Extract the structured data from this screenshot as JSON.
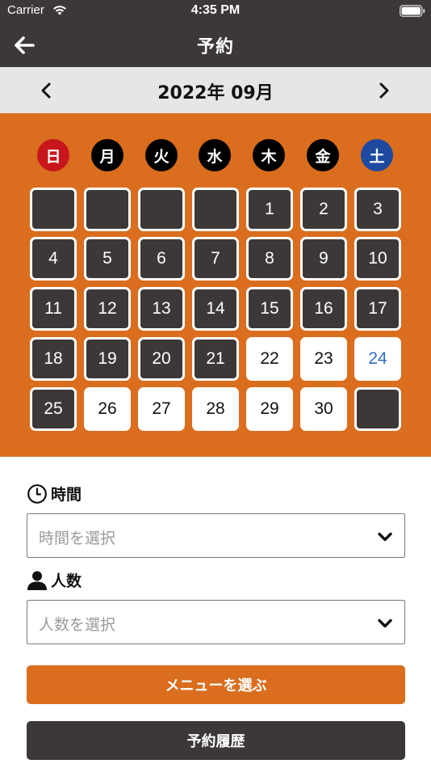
{
  "status": {
    "carrier": "Carrier",
    "time": "4:35 PM"
  },
  "nav": {
    "back_icon": "arrow-left-icon",
    "title": "予約"
  },
  "month": {
    "title": "2022年 09月",
    "prev_icon": "chevron-left-icon",
    "next_icon": "chevron-right-icon"
  },
  "weekdays": [
    "日",
    "月",
    "火",
    "水",
    "木",
    "金",
    "土"
  ],
  "calendar": {
    "weeks": [
      [
        {
          "d": "",
          "s": "dark"
        },
        {
          "d": "",
          "s": "dark"
        },
        {
          "d": "",
          "s": "dark"
        },
        {
          "d": "",
          "s": "dark"
        },
        {
          "d": "1",
          "s": "dark"
        },
        {
          "d": "2",
          "s": "dark"
        },
        {
          "d": "3",
          "s": "dark"
        }
      ],
      [
        {
          "d": "4",
          "s": "dark"
        },
        {
          "d": "5",
          "s": "dark"
        },
        {
          "d": "6",
          "s": "dark"
        },
        {
          "d": "7",
          "s": "dark"
        },
        {
          "d": "8",
          "s": "dark"
        },
        {
          "d": "9",
          "s": "dark"
        },
        {
          "d": "10",
          "s": "dark"
        }
      ],
      [
        {
          "d": "11",
          "s": "dark"
        },
        {
          "d": "12",
          "s": "dark"
        },
        {
          "d": "13",
          "s": "dark"
        },
        {
          "d": "14",
          "s": "dark"
        },
        {
          "d": "15",
          "s": "dark"
        },
        {
          "d": "16",
          "s": "dark"
        },
        {
          "d": "17",
          "s": "dark"
        }
      ],
      [
        {
          "d": "18",
          "s": "dark"
        },
        {
          "d": "19",
          "s": "dark"
        },
        {
          "d": "20",
          "s": "dark"
        },
        {
          "d": "21",
          "s": "dark"
        },
        {
          "d": "22",
          "s": "light"
        },
        {
          "d": "23",
          "s": "light"
        },
        {
          "d": "24",
          "s": "light"
        }
      ],
      [
        {
          "d": "25",
          "s": "dark"
        },
        {
          "d": "26",
          "s": "light"
        },
        {
          "d": "27",
          "s": "light"
        },
        {
          "d": "28",
          "s": "light"
        },
        {
          "d": "29",
          "s": "light"
        },
        {
          "d": "30",
          "s": "light"
        },
        {
          "d": "",
          "s": "dark"
        }
      ]
    ]
  },
  "form": {
    "time_label": "時間",
    "time_icon": "clock-icon",
    "time_placeholder": "時間を選択",
    "people_label": "人数",
    "people_icon": "person-icon",
    "people_placeholder": "人数を選択",
    "dropdown_icon": "chevron-down-icon"
  },
  "buttons": {
    "menu": "メニューを選ぶ",
    "history": "予約履歴"
  },
  "colors": {
    "accent_orange": "#da6e1e",
    "dark": "#3d3838",
    "sunday_red": "#c8171c",
    "saturday_blue": "#1d4aa0",
    "saturday_text_blue": "#2f6cc4"
  }
}
